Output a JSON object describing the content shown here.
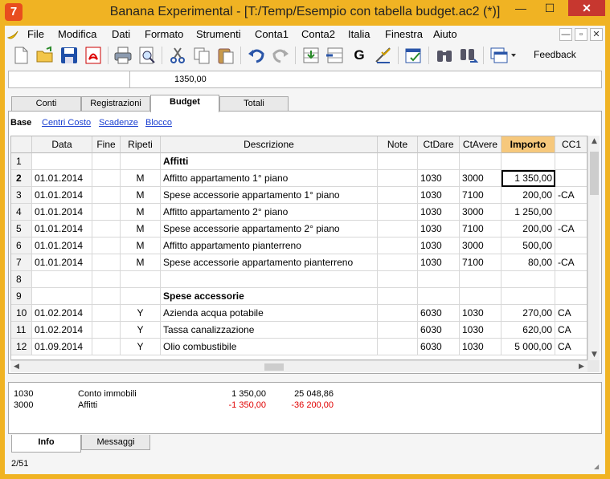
{
  "app": {
    "logo": "7",
    "title": "Banana Experimental - [T:/Temp/Esempio con tabella budget.ac2 (*)]",
    "window_buttons": [
      "—",
      "☐",
      "✕"
    ]
  },
  "menu": {
    "items": [
      "File",
      "Modifica",
      "Dati",
      "Formato",
      "Strumenti",
      "Conta1",
      "Conta2",
      "Italia",
      "Finestra",
      "Aiuto"
    ],
    "mdi_buttons": [
      "—",
      "▫",
      "✕"
    ]
  },
  "toolbar": {
    "icons": [
      "new-document-icon",
      "open-folder-icon",
      "save-icon",
      "pdf-icon",
      "print-icon",
      "print-preview-icon",
      "cut-icon",
      "copy-icon",
      "paste-icon",
      "undo-icon",
      "redo-icon",
      "insert-rows-icon",
      "add-row-icon",
      "g-icon",
      "check-icon",
      "accounts-icon",
      "search-icon",
      "find-replace-icon",
      "window-dropdown-icon"
    ],
    "g_label": "G",
    "feedback_label": "Feedback"
  },
  "cellbar": {
    "ref": "",
    "value": "1350,00"
  },
  "tabs": [
    "Conti",
    "Registrazioni",
    "Budget",
    "Totali"
  ],
  "active_tab": "Budget",
  "views": {
    "active": "Base",
    "links": [
      "Centri Costo",
      "Scadenze",
      "Blocco"
    ]
  },
  "grid": {
    "columns": [
      "",
      "Data",
      "Fine",
      "Ripeti",
      "Descrizione",
      "Note",
      "CtDare",
      "CtAvere",
      "Importo",
      "CC1"
    ],
    "rows": [
      {
        "n": "1",
        "data": "",
        "fine": "",
        "ripeti": "",
        "desc": "Affitti",
        "note": "",
        "dare": "",
        "avere": "",
        "importo": "",
        "cc1": "",
        "bold": true
      },
      {
        "n": "2",
        "data": "01.01.2014",
        "fine": "",
        "ripeti": "M",
        "desc": "Affitto appartamento 1° piano",
        "note": "",
        "dare": "1030",
        "avere": "3000",
        "importo": "1 350,00",
        "cc1": "",
        "current": true
      },
      {
        "n": "3",
        "data": "01.01.2014",
        "fine": "",
        "ripeti": "M",
        "desc": "Spese accessorie appartamento 1° piano",
        "note": "",
        "dare": "1030",
        "avere": "7100",
        "importo": "200,00",
        "cc1": "-CA"
      },
      {
        "n": "4",
        "data": "01.01.2014",
        "fine": "",
        "ripeti": "M",
        "desc": "Affitto appartamento 2° piano",
        "note": "",
        "dare": "1030",
        "avere": "3000",
        "importo": "1 250,00",
        "cc1": ""
      },
      {
        "n": "5",
        "data": "01.01.2014",
        "fine": "",
        "ripeti": "M",
        "desc": "Spese accessorie appartamento 2° piano",
        "note": "",
        "dare": "1030",
        "avere": "7100",
        "importo": "200,00",
        "cc1": "-CA"
      },
      {
        "n": "6",
        "data": "01.01.2014",
        "fine": "",
        "ripeti": "M",
        "desc": "Affitto appartamento pianterreno",
        "note": "",
        "dare": "1030",
        "avere": "3000",
        "importo": "500,00",
        "cc1": ""
      },
      {
        "n": "7",
        "data": "01.01.2014",
        "fine": "",
        "ripeti": "M",
        "desc": "Spese accessorie appartamento pianterreno",
        "note": "",
        "dare": "1030",
        "avere": "7100",
        "importo": "80,00",
        "cc1": "-CA"
      },
      {
        "n": "8",
        "data": "",
        "fine": "",
        "ripeti": "",
        "desc": "",
        "note": "",
        "dare": "",
        "avere": "",
        "importo": "",
        "cc1": ""
      },
      {
        "n": "9",
        "data": "",
        "fine": "",
        "ripeti": "",
        "desc": "Spese accessorie",
        "note": "",
        "dare": "",
        "avere": "",
        "importo": "",
        "cc1": "",
        "bold": true
      },
      {
        "n": "10",
        "data": "01.02.2014",
        "fine": "",
        "ripeti": "Y",
        "desc": "Azienda acqua potabile",
        "note": "",
        "dare": "6030",
        "avere": "1030",
        "importo": "270,00",
        "cc1": "CA"
      },
      {
        "n": "11",
        "data": "01.02.2014",
        "fine": "",
        "ripeti": "Y",
        "desc": "Tassa canalizzazione",
        "note": "",
        "dare": "6030",
        "avere": "1030",
        "importo": "620,00",
        "cc1": "CA"
      },
      {
        "n": "12",
        "data": "01.09.2014",
        "fine": "",
        "ripeti": "Y",
        "desc": "Olio combustibile",
        "note": "",
        "dare": "6030",
        "avere": "1030",
        "importo": "5 000,00",
        "cc1": "CA"
      }
    ]
  },
  "info_rows": [
    {
      "account": "1030",
      "name": "Conto immobili",
      "amount": "1 350,00",
      "balance": "25 048,86",
      "negative": false
    },
    {
      "account": "3000",
      "name": "Affitti",
      "amount": "-1 350,00",
      "balance": "-36 200,00",
      "negative": true
    }
  ],
  "bottom_tabs": [
    "Info",
    "Messaggi"
  ],
  "status": "2/51",
  "colors": {
    "accent": "#f0b323",
    "highlight_header": "#f6c87c",
    "link": "#1a3fd0",
    "negative": "#e00000"
  }
}
